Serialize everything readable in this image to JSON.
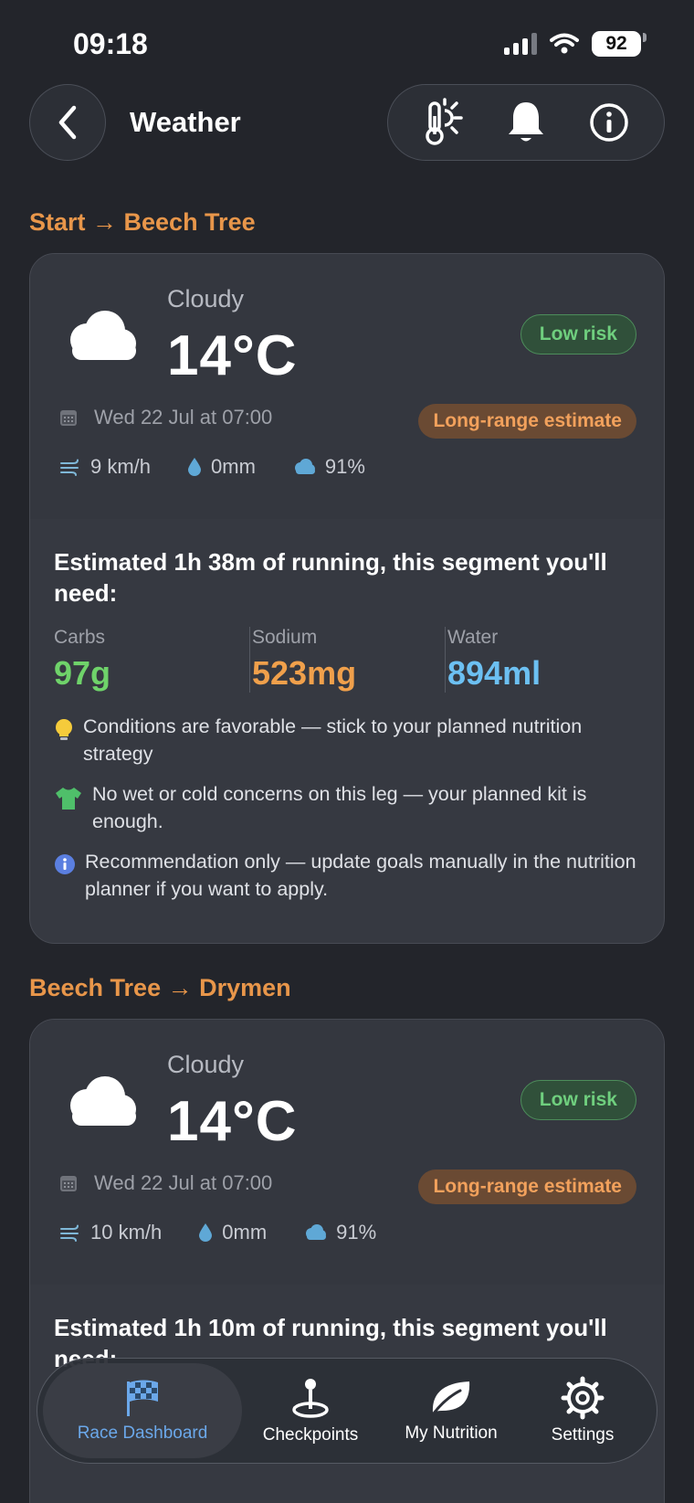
{
  "status": {
    "time": "09:18",
    "battery": "92"
  },
  "header": {
    "title": "Weather"
  },
  "segments": [
    {
      "title": "Start → Beech Tree",
      "condition": "Cloudy",
      "temp": "14°C",
      "risk": "Low risk",
      "date": "Wed 22 Jul at 07:00",
      "estimate": "Long-range estimate",
      "wind": "9 km/h",
      "rain": "0mm",
      "cloud": "91%",
      "need": "Estimated 1h 38m of running, this segment you'll need:",
      "carbs_label": "Carbs",
      "carbs": "97g",
      "sodium_label": "Sodium",
      "sodium": "523mg",
      "water_label": "Water",
      "water": "894ml",
      "tips": [
        "Conditions are favorable — stick to your planned nutrition strategy",
        "No wet or cold concerns on this leg — your planned kit is enough.",
        "Recommendation only — update goals manually in the nutrition planner if you want to apply."
      ]
    },
    {
      "title": "Beech Tree → Drymen",
      "condition": "Cloudy",
      "temp": "14°C",
      "risk": "Low risk",
      "date": "Wed 22 Jul at 07:00",
      "estimate": "Long-range estimate",
      "wind": "10 km/h",
      "rain": "0mm",
      "cloud": "91%",
      "need": "Estimated 1h 10m of running, this segment you'll need:"
    }
  ],
  "tabs": [
    {
      "label": "Race Dashboard",
      "icon": "checkered-flag-icon"
    },
    {
      "label": "Checkpoints",
      "icon": "map-pin-icon"
    },
    {
      "label": "My Nutrition",
      "icon": "leaf-icon"
    },
    {
      "label": "Settings",
      "icon": "gear-icon"
    }
  ],
  "colors": {
    "accent": "#e8964a",
    "carbs": "#6fd36a",
    "sodium": "#f0a04b",
    "water": "#6cc0f2",
    "active_tab": "#6ba8ea"
  }
}
